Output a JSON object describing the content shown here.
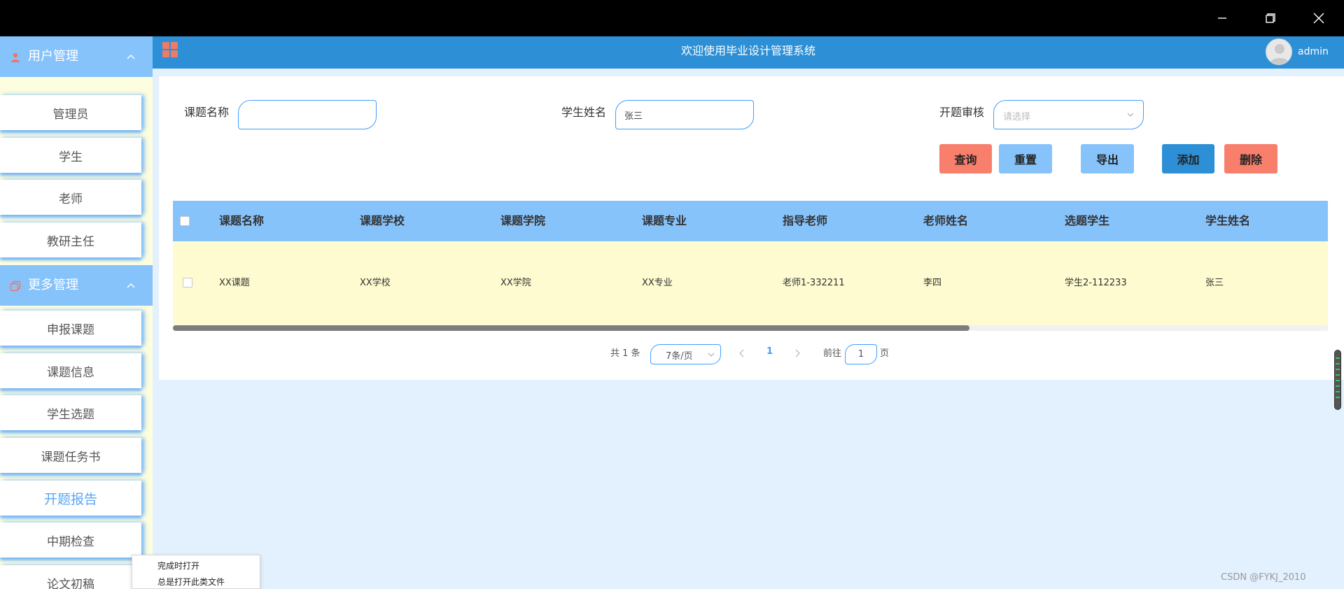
{
  "sidebar": {
    "groups": [
      {
        "label": "用户管理",
        "items": [
          "管理员",
          "学生",
          "老师",
          "教研主任"
        ]
      },
      {
        "label": "更多管理",
        "items": [
          "申报课题",
          "课题信息",
          "学生选题",
          "课题任务书",
          "开题报告",
          "中期检查",
          "论文初稿"
        ]
      }
    ],
    "active_item": "开题报告"
  },
  "header": {
    "title": "欢迎使用毕业设计管理系统",
    "username": "admin"
  },
  "search": {
    "topic_label": "课题名称",
    "topic_value": "",
    "student_label": "学生姓名",
    "student_value": "张三",
    "review_label": "开题审核",
    "review_placeholder": "请选择"
  },
  "buttons": {
    "query": "查询",
    "reset": "重置",
    "export": "导出",
    "add": "添加",
    "delete": "删除"
  },
  "colors": {
    "header": "#2d8fd6",
    "accent": "#409eff",
    "query_btn": "#f87f6c",
    "reset_btn": "#87c3fb",
    "export_btn": "#87c3fb",
    "add_btn": "#2d8fd6",
    "delete_btn": "#f87f6c"
  },
  "table": {
    "columns": [
      "课题名称",
      "课题学校",
      "课题学院",
      "课题专业",
      "指导老师",
      "老师姓名",
      "选题学生",
      "学生姓名"
    ],
    "rows": [
      [
        "XX课题",
        "XX学校",
        "XX学院",
        "XX专业",
        "老师1-332211",
        "李四",
        "学生2-112233",
        "张三"
      ]
    ]
  },
  "pagination": {
    "total_text": "共 1 条",
    "page_size": "7条/页",
    "current_page": "1",
    "goto_label": "前往",
    "goto_value": "1",
    "page_suffix": "页"
  },
  "popup": {
    "items": [
      "完成时打开",
      "总是打开此类文件"
    ]
  },
  "watermark": "CSDN @FYKJ_2010"
}
